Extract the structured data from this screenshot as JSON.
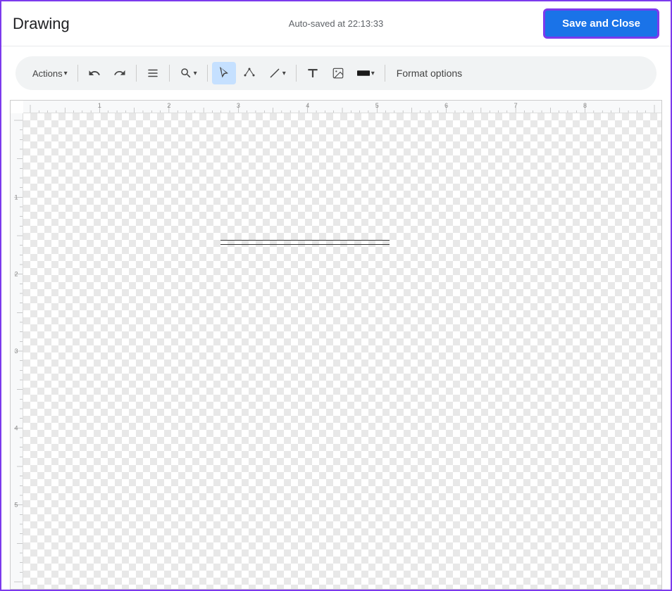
{
  "header": {
    "title": "Drawing",
    "autosave": "Auto-saved at 22:13:33",
    "save_close_label": "Save and Close"
  },
  "toolbar": {
    "actions_label": "Actions",
    "actions_chevron": "▾",
    "undo_icon": "↩",
    "redo_icon": "↪",
    "select_menu_icon": "⊟",
    "zoom_icon": "⊕",
    "zoom_chevron": "▾",
    "cursor_icon": "↖",
    "shape_icon": "⊕",
    "line_icon": "/",
    "line_chevron": "▾",
    "text_icon": "T",
    "image_icon": "🖼",
    "color_icon": "▬",
    "color_chevron": "▾",
    "format_options_label": "Format options"
  },
  "canvas": {
    "ruler_labels_top": [
      "1",
      "2",
      "3",
      "4",
      "5",
      "6",
      "7",
      "8"
    ],
    "ruler_labels_left": [
      "1",
      "2",
      "3",
      "4",
      "5"
    ]
  }
}
